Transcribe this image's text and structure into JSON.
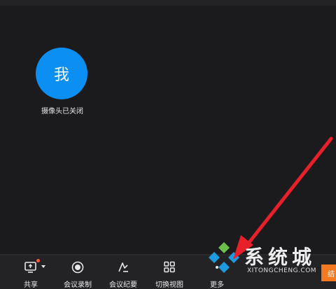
{
  "participant": {
    "avatar_text": "我",
    "status_label": "摄像头已关闭"
  },
  "toolbar": {
    "buttons": [
      {
        "label": "共享",
        "icon": "screen-share-icon"
      },
      {
        "label": "会议录制",
        "icon": "record-icon"
      },
      {
        "label": "会议纪要",
        "icon": "ai-notes-icon"
      },
      {
        "label": "切换视图",
        "icon": "grid-view-icon"
      },
      {
        "label": "更多",
        "icon": "more-icon"
      }
    ]
  },
  "watermark": {
    "brand": "系统城",
    "url": "XITONGCHENG.COM",
    "tab_text": "结"
  },
  "colors": {
    "avatar": "#0b8ff2",
    "arrow": "#e8202a",
    "accent_orange": "#f57a1f",
    "share_dot": "#ff5a3c"
  }
}
